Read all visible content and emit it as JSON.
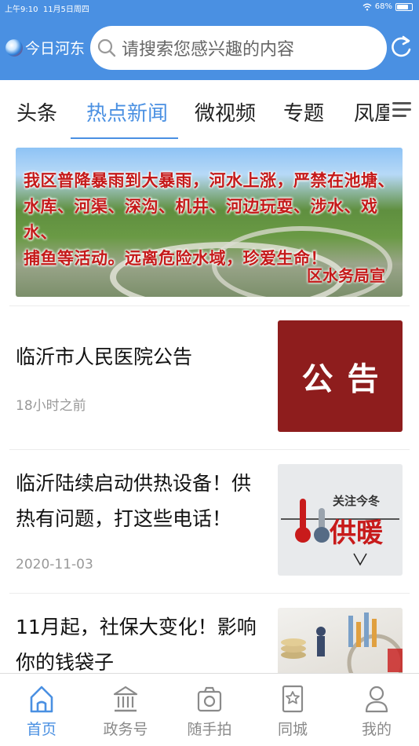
{
  "status_bar": {
    "time": "上午9:10",
    "date": "11月5日周四",
    "battery": "68%"
  },
  "header": {
    "app_name": "今日河东",
    "search_placeholder": "请搜索您感兴趣的内容"
  },
  "tabs": [
    {
      "label": "头条",
      "active": false
    },
    {
      "label": "热点新闻",
      "active": true
    },
    {
      "label": "微视频",
      "active": false
    },
    {
      "label": "专题",
      "active": false
    },
    {
      "label": "凤凰",
      "active": false
    }
  ],
  "banner": {
    "line1": "我区普降暴雨到大暴雨，河水上涨，严禁在池塘、",
    "line2": "水库、河渠、深沟、机井、河边玩耍、涉水、戏水、",
    "line3": "捕鱼等活动。远离危险水域，珍爱生命！",
    "sign": "区水务局宣"
  },
  "news": [
    {
      "title": "临沂市人民医院公告",
      "time": "18小时之前",
      "thumb_text": "公告"
    },
    {
      "title": "临沂陆续启动供热设备！供热有问题，打这些电话！",
      "time": "2020-11-03",
      "thumb_text_top": "关注今冬",
      "thumb_text_main": "供暖"
    },
    {
      "title": "11月起，社保大变化！影响你的钱袋子",
      "time": ""
    }
  ],
  "bottom_nav": [
    {
      "label": "首页",
      "icon": "home-icon",
      "active": true
    },
    {
      "label": "政务号",
      "icon": "government-building-icon",
      "active": false
    },
    {
      "label": "随手拍",
      "icon": "camera-icon",
      "active": false
    },
    {
      "label": "同城",
      "icon": "star-bookmark-icon",
      "active": false
    },
    {
      "label": "我的",
      "icon": "user-icon",
      "active": false
    }
  ],
  "colors": {
    "accent": "#4A90E2",
    "banner_text": "#C51A1A",
    "notice_bg": "#8E1D1D"
  }
}
